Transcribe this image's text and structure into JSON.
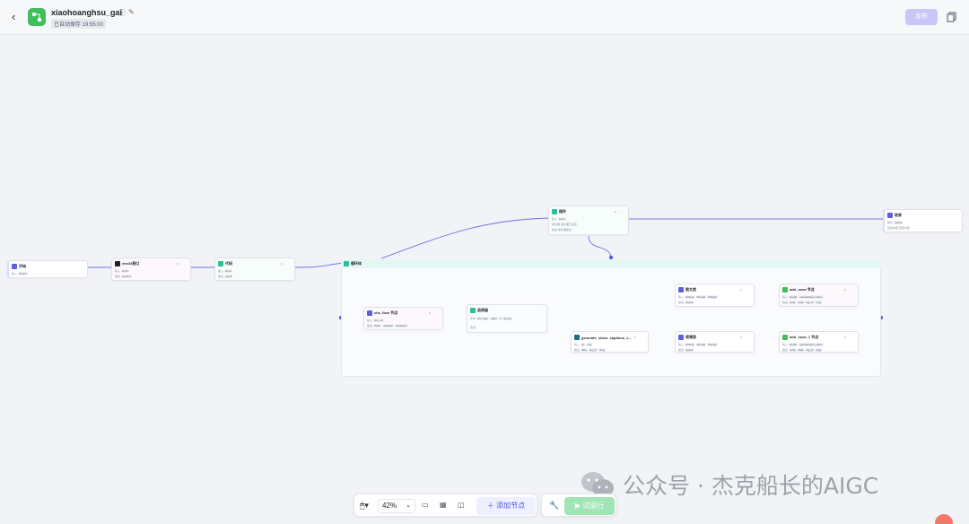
{
  "header": {
    "back_icon": "chevron-left-icon",
    "app_name": "xiaohoanghsu_gai",
    "info_icon": "info-icon",
    "edit_icon": "edit-icon",
    "saved_text": "已自动保存 19:55:00",
    "publish_label": "发布",
    "publish_color": "#c9c7f8"
  },
  "nodes": {
    "start": {
      "title": "开始",
      "row1_label": "输入",
      "row1_tag": "xhsUrl"
    },
    "xhs_node": {
      "title": "xhs34接口",
      "row1_label": "输入",
      "row1_tag": "input",
      "row2_label": "输出",
      "row2_tag": "content"
    },
    "code": {
      "title": "代码",
      "row1_label": "输入",
      "row1_tag": "input",
      "row2_label": "输出",
      "row2_tag": "result"
    },
    "llm": {
      "title": "插件",
      "row1_label": "输入",
      "row1_tag": "input",
      "row2_label": "批处理",
      "row2_text": "批处理已设置",
      "row3_label": "输出",
      "row3_text": "批处理输出"
    },
    "end": {
      "title": "结束",
      "row1_label": "输出",
      "row1_tag": "output",
      "row2_label": "回答内容",
      "row2_text": "回答内容"
    },
    "loop": {
      "title": "循环体"
    },
    "xhs_flow": {
      "title": "xhs_flow 节点",
      "row1_label": "输入",
      "row1_tag": "xhs_url",
      "row2_label": "输出",
      "row2_tags": [
        "video",
        "duration",
        "duration1"
      ]
    },
    "selector": {
      "title": "选择器",
      "row1_label": "条件",
      "row1_tags": [
        "xhs_flow",
        "video",
        "≠",
        "Empty"
      ],
      "row2_label": "否则"
    },
    "captions": {
      "title": "generate_video_captions_s…",
      "row1_label": "输入",
      "row1_tags": [
        "url",
        "img"
      ],
      "row2_label": "输出",
      "row2_tags": [
        "data",
        "log_id",
        "msg"
      ]
    },
    "picture": {
      "title": "图文类",
      "row1_label": "输入",
      "row1_tags": [
        "String1",
        "String2",
        "String3"
      ],
      "row2_label": "输出",
      "row2_tag": "output"
    },
    "video": {
      "title": "视频类",
      "row1_label": "输入",
      "row1_tags": [
        "String1",
        "String2",
        "String3"
      ],
      "row2_label": "输出",
      "row2_tag": "output"
    },
    "add_rows": {
      "title": "add_rows 节点",
      "row1_label": "输入",
      "row1_tags": [
        "length",
        "spreadsheet_token"
      ],
      "row2_label": "输出",
      "row2_tags": [
        "code",
        "data",
        "log_id",
        "msg"
      ]
    },
    "add_rows1": {
      "title": "add_rows_1 节点",
      "row1_label": "输入",
      "row1_tags": [
        "length",
        "spreadsheet_token"
      ],
      "row2_label": "输出",
      "row2_tags": [
        "code",
        "data",
        "log_id",
        "msg"
      ]
    }
  },
  "toolbar": {
    "mouse_icon": "mouse-icon",
    "zoom": "42%",
    "comment_icon": "comment-icon",
    "layout_icon": "grid-layout-icon",
    "minimap_icon": "minimap-icon",
    "add_node_label": "添加节点",
    "wrench_icon": "wrench-icon",
    "run_label": "试运行",
    "run_color": "#9fe5b6",
    "accent": "#4d53e8"
  },
  "watermark": {
    "text": "公众号 · 杰克船长的AIGC",
    "icon": "wechat-icon"
  }
}
